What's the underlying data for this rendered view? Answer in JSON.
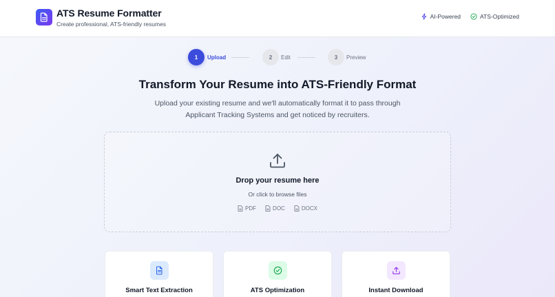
{
  "header": {
    "title": "ATS Resume Formatter",
    "subtitle": "Create professional, ATS-friendly resumes",
    "logo_icon": "document-icon",
    "badges": [
      {
        "label": "AI-Powered",
        "icon": "lightning-icon",
        "color": "#4f46e5"
      },
      {
        "label": "ATS-Optimized",
        "icon": "check-circle-icon",
        "color": "#16a34a"
      }
    ]
  },
  "stepper": {
    "steps": [
      {
        "number": "1",
        "label": "Upload",
        "active": true
      },
      {
        "number": "2",
        "label": "Edit",
        "active": false
      },
      {
        "number": "3",
        "label": "Preview",
        "active": false
      }
    ]
  },
  "hero": {
    "title": "Transform Your Resume into ATS-Friendly Format",
    "description": "Upload your existing resume and we'll automatically format it to pass through Applicant Tracking Systems and get noticed by recruiters."
  },
  "dropzone": {
    "icon": "upload-icon",
    "title": "Drop your resume here",
    "subtitle": "Or click to browse files",
    "formats": [
      "PDF",
      "DOC",
      "DOCX"
    ]
  },
  "features": [
    {
      "title": "Smart Text Extraction",
      "icon": "document-icon",
      "bg": "#dbeafe",
      "fg": "#2563eb"
    },
    {
      "title": "ATS Optimization",
      "icon": "check-circle-icon",
      "bg": "#dcfce7",
      "fg": "#16a34a"
    },
    {
      "title": "Instant Download",
      "icon": "upload-icon",
      "bg": "#f3e8ff",
      "fg": "#9333ea"
    }
  ],
  "colors": {
    "accent": "#3b4bdb",
    "logo_gradient_start": "#3b5bf6",
    "logo_gradient_end": "#7c3aed"
  }
}
